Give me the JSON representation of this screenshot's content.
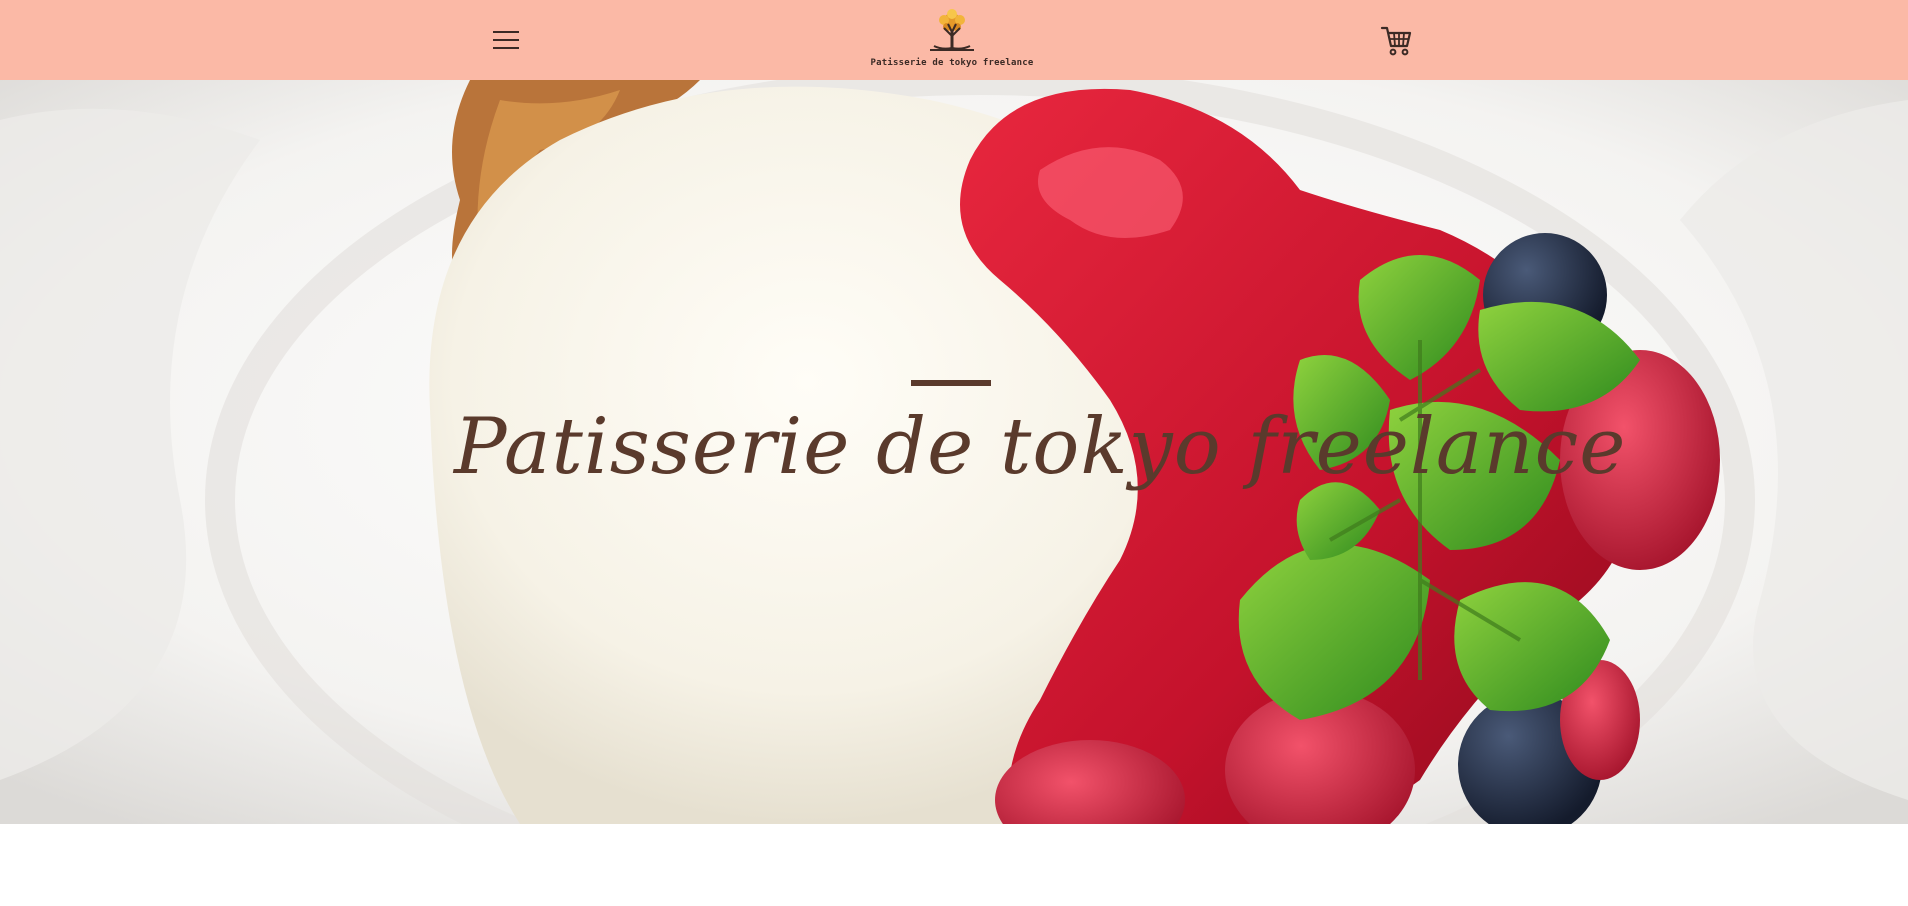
{
  "header": {
    "background_color": "#fbb9a6",
    "menu_icon": "hamburger-menu-icon",
    "logo_text": "Patisserie de tokyo freelance",
    "cart_icon": "shopping-cart-icon"
  },
  "hero": {
    "title": "Patisserie de tokyo freelance",
    "text_color": "#5a3a2c",
    "image_subject": "panna cotta with raspberry sauce, berries and mint"
  }
}
